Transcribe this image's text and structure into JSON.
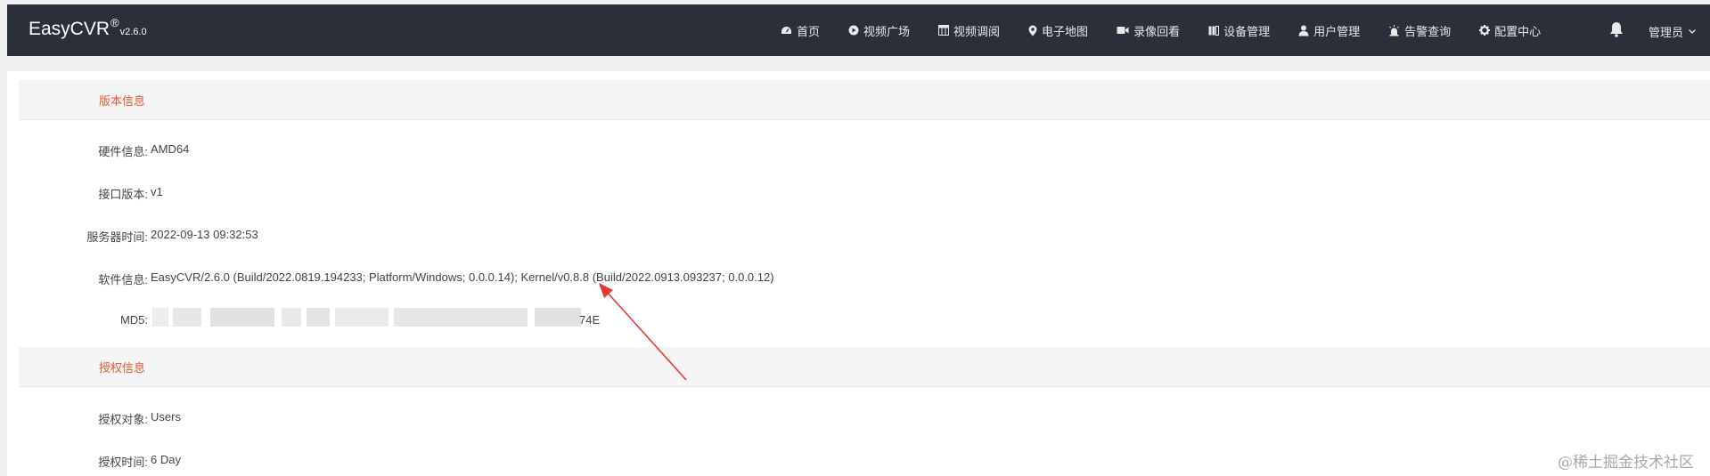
{
  "header": {
    "brand": "EasyCVR",
    "registered": "®",
    "version": "v2.6.0",
    "nav": [
      {
        "icon": "dashboard-icon",
        "label": "首页"
      },
      {
        "icon": "play-circle-icon",
        "label": "视频广场"
      },
      {
        "icon": "grid-icon",
        "label": "视频调阅"
      },
      {
        "icon": "map-pin-icon",
        "label": "电子地图"
      },
      {
        "icon": "video-camera-icon",
        "label": "录像回看"
      },
      {
        "icon": "columns-icon",
        "label": "设备管理"
      },
      {
        "icon": "user-icon",
        "label": "用户管理"
      },
      {
        "icon": "alarm-icon",
        "label": "告警查询"
      },
      {
        "icon": "gear-icon",
        "label": "配置中心"
      }
    ],
    "bell_icon": "bell-icon",
    "user_label": "管理员",
    "user_caret_icon": "chevron-down-icon"
  },
  "sections": {
    "version": {
      "title": "版本信息",
      "rows": [
        {
          "label": "硬件信息:",
          "value": "AMD64"
        },
        {
          "label": "接口版本:",
          "value": "v1"
        },
        {
          "label": "服务器时间:",
          "value": "2022-09-13 09:32:53"
        },
        {
          "label": "软件信息:",
          "value": "EasyCVR/2.6.0 (Build/2022.0819.194233; Platform/Windows; 0.0.0.14); Kernel/v0.8.8 (Build/2022.0913.093237; 0.0.0.12)"
        },
        {
          "label": "MD5:",
          "value": "74E"
        }
      ]
    },
    "license": {
      "title": "授权信息",
      "rows": [
        {
          "label": "授权对象:",
          "value": "Users"
        },
        {
          "label": "授权时间:",
          "value": "6 Day"
        }
      ]
    }
  },
  "watermark": "@稀土掘金技术社区",
  "colors": {
    "topbar": "#2b2f3a",
    "section_title": "#e75a2c",
    "arrow": "#e53935"
  }
}
